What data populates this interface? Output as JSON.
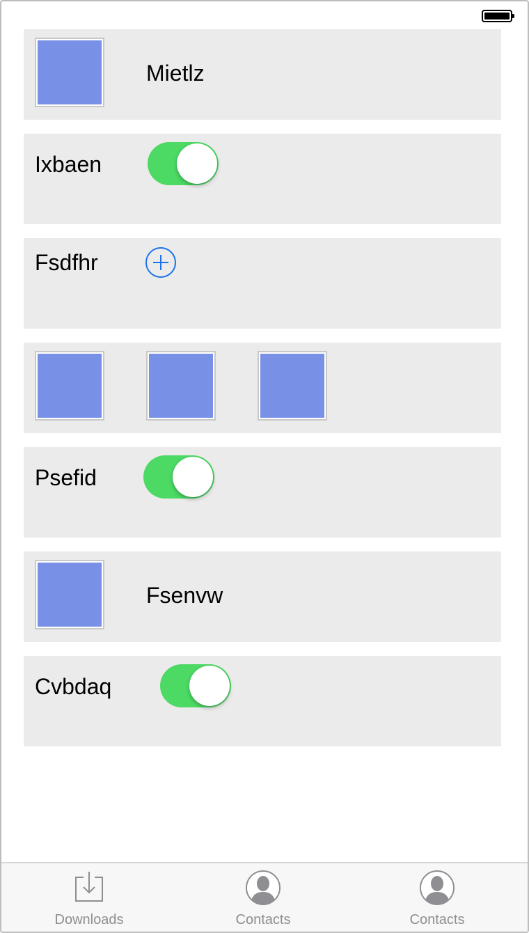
{
  "status_bar": {
    "battery_icon": "battery-full-icon"
  },
  "rows": [
    {
      "type": "image-label",
      "label": "Mietlz"
    },
    {
      "type": "label-toggle",
      "label": "Ixbaen",
      "toggle_on": true
    },
    {
      "type": "label-add",
      "label": "Fsdfhr",
      "icon": "add-circle-icon"
    },
    {
      "type": "images",
      "count": 3
    },
    {
      "type": "label-toggle",
      "label": "Psefid",
      "toggle_on": true
    },
    {
      "type": "image-label",
      "label": "Fsenvw"
    },
    {
      "type": "label-toggle",
      "label": "Cvbdaq",
      "toggle_on": true
    }
  ],
  "tab_bar": {
    "tabs": [
      {
        "label": "Downloads",
        "icon": "download-icon"
      },
      {
        "label": "Contacts",
        "icon": "contact-icon"
      },
      {
        "label": "Contacts",
        "icon": "contact-icon"
      }
    ]
  },
  "colors": {
    "row_background": "#ebebeb",
    "image_placeholder": "#7891e6",
    "toggle_on": "#4cd964",
    "accent": "#1a73e8",
    "tab_label": "#8e8e93"
  }
}
